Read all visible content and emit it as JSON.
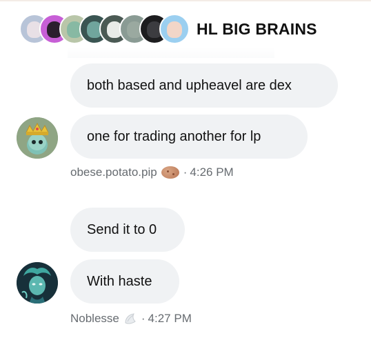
{
  "header": {
    "title": "HL BIG BRAINS",
    "member_avatars": [
      {
        "name": "member-1",
        "bg": "#b8c4d8",
        "face": "#e8e0e6"
      },
      {
        "name": "member-2",
        "bg": "#c75fd6",
        "face": "#2b1f2e"
      },
      {
        "name": "member-3",
        "bg": "#b9c6a9",
        "face": "#87b9a3"
      },
      {
        "name": "member-4",
        "bg": "#3a5552",
        "face": "#70a59d"
      },
      {
        "name": "member-5",
        "bg": "#4b5a54",
        "face": "#e9ebe8"
      },
      {
        "name": "member-6",
        "bg": "#8a9b94",
        "face": "#9aa9a0"
      },
      {
        "name": "member-7",
        "bg": "#1d1d1f",
        "face": "#3c3c40"
      },
      {
        "name": "member-8",
        "bg": "#9bcff0",
        "face": "#f2d6c8"
      }
    ]
  },
  "messages": [
    {
      "text": "both based and upheavel are dex"
    },
    {
      "text": "one for trading another for lp"
    },
    {
      "text": "Send it to 0"
    },
    {
      "text": "With haste"
    }
  ],
  "senders": [
    {
      "name": "obese.potato.pip",
      "emoji": "potato-icon",
      "time": "4:26 PM",
      "separator": "·"
    },
    {
      "name": "Noblesse",
      "emoji": "shell-icon",
      "time": "4:27 PM",
      "separator": "·"
    }
  ],
  "colors": {
    "bubble": "#f0f2f4",
    "meta_text": "#666b70",
    "title_text": "#111111"
  }
}
